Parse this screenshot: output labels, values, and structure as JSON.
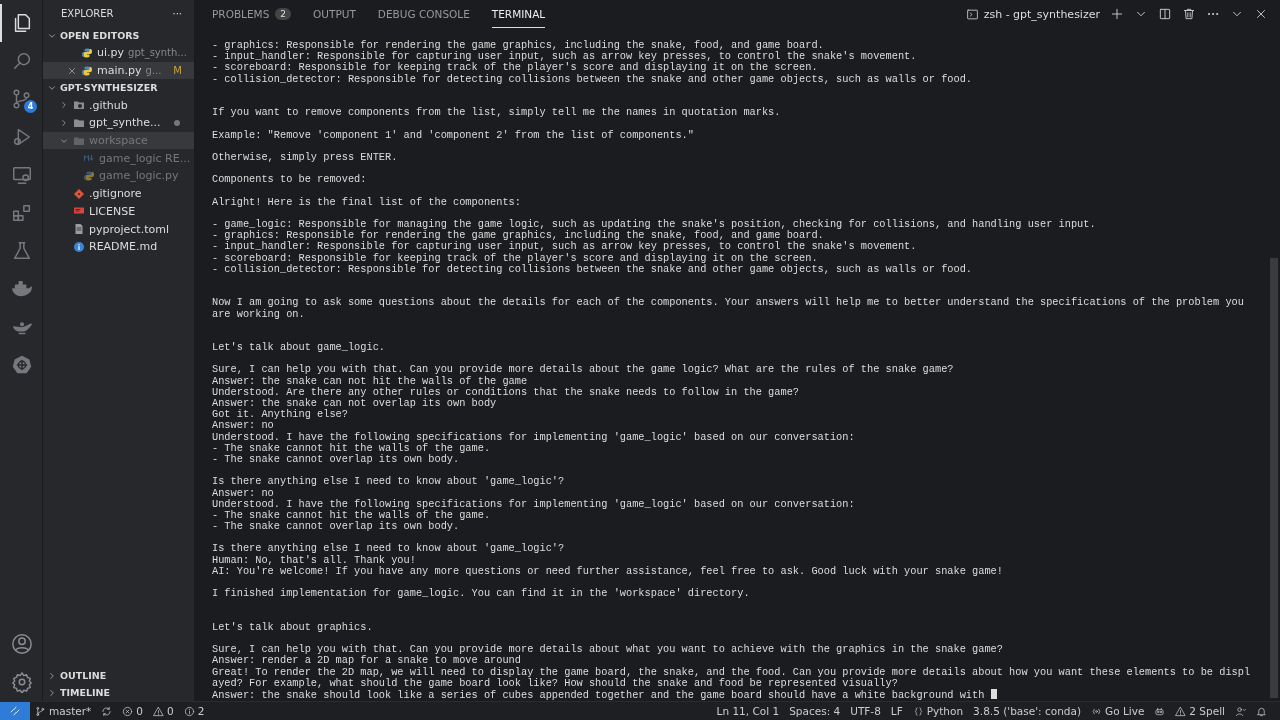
{
  "activity_bar": {
    "items": [
      {
        "kind": "files",
        "selected": true
      },
      {
        "kind": "search",
        "selected": false
      },
      {
        "kind": "source-control",
        "selected": false,
        "badge": "4"
      },
      {
        "kind": "debug",
        "selected": false
      },
      {
        "kind": "remote",
        "selected": false
      },
      {
        "kind": "extensions",
        "selected": false
      },
      {
        "kind": "testing",
        "selected": false
      },
      {
        "kind": "docker",
        "selected": false
      },
      {
        "kind": "lamp",
        "selected": false
      },
      {
        "kind": "helm",
        "selected": false
      }
    ],
    "bottom": [
      {
        "kind": "account"
      },
      {
        "kind": "settings"
      }
    ]
  },
  "sidebar": {
    "title": "EXPLORER",
    "more": "···",
    "sections": [
      {
        "title": "OPEN EDITORS",
        "expanded": true,
        "items": [
          {
            "name": "ui.py",
            "kind": "python",
            "description": "gpt_synth...",
            "selected": false,
            "close": false
          },
          {
            "name": "main.py",
            "kind": "python",
            "description": "g...",
            "selected": true,
            "close": true,
            "status": "M"
          }
        ]
      },
      {
        "title": "GPT-SYNTHESIZER",
        "expanded": true,
        "items": [
          {
            "name": ".github",
            "kind": "github-folder",
            "expanded": false,
            "ignored": false,
            "selected": false
          },
          {
            "name": "gpt_synthe...",
            "kind": "folder",
            "expanded": false,
            "ignored": false,
            "selected": false,
            "dot": true
          },
          {
            "name": "workspace",
            "kind": "folder",
            "expanded": true,
            "ignored": true,
            "selected": true,
            "children": [
              {
                "name": "game_logic RE...",
                "kind": "markdown",
                "ignored": true,
                "selected": false
              },
              {
                "name": "game_logic.py",
                "kind": "python",
                "ignored": true,
                "selected": false
              }
            ]
          },
          {
            "name": ".gitignore",
            "kind": "git",
            "ignored": false,
            "selected": false
          },
          {
            "name": "LICENSE",
            "kind": "license",
            "ignored": false,
            "selected": false
          },
          {
            "name": "pyproject.toml",
            "kind": "toml",
            "ignored": false,
            "selected": false
          },
          {
            "name": "README.md",
            "kind": "info",
            "ignored": false,
            "selected": false
          }
        ]
      }
    ],
    "bottom_sections": [
      {
        "title": "OUTLINE",
        "expanded": false
      },
      {
        "title": "TIMELINE",
        "expanded": false
      }
    ]
  },
  "panel": {
    "tabs": [
      {
        "label": "PROBLEMS",
        "selected": false,
        "badge": "2"
      },
      {
        "label": "OUTPUT",
        "selected": false
      },
      {
        "label": "DEBUG CONSOLE",
        "selected": false
      },
      {
        "label": "TERMINAL",
        "selected": true
      }
    ],
    "terminal_name": "zsh - gpt_synthesizer",
    "actions": [
      {
        "kind": "add"
      },
      {
        "kind": "chevron"
      },
      {
        "kind": "split"
      },
      {
        "kind": "trash"
      },
      {
        "kind": "more"
      },
      {
        "kind": "collapse"
      },
      {
        "kind": "close"
      }
    ],
    "terminal": [
      {
        "kind": "first",
        "lines": [
          "- graphics: Responsible for rendering the game graphics, including the snake, food, and game board.",
          "- input_handler: Responsible for capturing user input, such as arrow key presses, to control the snake's movement.",
          "- scoreboard: Responsible for keeping track of the player's score and displaying it on the screen.",
          "- collision_detector: Responsible for detecting collisions between the snake and other game objects, such as walls or food."
        ]
      },
      {
        "kind": "after_two_blanks",
        "lines": [
          "If you want to remove components from the list, simply tell me the names in quotation marks."
        ]
      },
      {
        "kind": "after_blank",
        "lines": [
          "Example: \"Remove 'component 1' and 'component 2' from the list of components.\""
        ]
      },
      {
        "kind": "after_blank",
        "lines": [
          "Otherwise, simply press ENTER."
        ]
      },
      {
        "kind": "after_blank",
        "lines": [
          "Components to be removed:"
        ]
      },
      {
        "kind": "after_blank",
        "lines": [
          "Alright! Here is the final list of the components:"
        ]
      },
      {
        "kind": "after_blank",
        "lines": [
          "- game_logic: Responsible for managing the game logic, such as updating the snake's position, checking for collisions, and handling user input.",
          "- graphics: Responsible for rendering the game graphics, including the snake, food, and game board.",
          "- input_handler: Responsible for capturing user input, such as arrow key presses, to control the snake's movement.",
          "- scoreboard: Responsible for keeping track of the player's score and displaying it on the screen.",
          "- collision_detector: Responsible for detecting collisions between the snake and other game objects, such as walls or food."
        ]
      },
      {
        "kind": "after_two_blanks",
        "lines": [
          "Now I am going to ask some questions about the details for each of the components. Your answers will help me to better understand the specifications of the problem you",
          "are working on."
        ]
      },
      {
        "kind": "after_two_blanks",
        "lines": [
          "Let's talk about game_logic."
        ]
      },
      {
        "kind": "after_blank",
        "lines": [
          "Sure, I can help you with that. Can you provide more details about the game logic? What are the rules of the snake game?",
          "Answer: the snake can not hit the walls of the game",
          "Understood. Are there any other rules or conditions that the snake needs to follow in the game?",
          "Answer: the snake can not overlap its own body",
          "Got it. Anything else?",
          "Answer: no",
          "Understood. I have the following specifications for implementing 'game_logic' based on our conversation:",
          "- The snake cannot hit the walls of the game.",
          "- The snake cannot overlap its own body."
        ]
      },
      {
        "kind": "after_blank",
        "lines": [
          "Is there anything else I need to know about 'game_logic'?",
          "Answer: no",
          "Understood. I have the following specifications for implementing 'game_logic' based on our conversation:",
          "- The snake cannot hit the walls of the game.",
          "- The snake cannot overlap its own body."
        ]
      },
      {
        "kind": "after_blank",
        "lines": [
          "Is there anything else I need to know about 'game_logic'?",
          "Human: No, that's all. Thank you!",
          "AI: You're welcome! If you have any more questions or need further assistance, feel free to ask. Good luck with your snake game!"
        ]
      },
      {
        "kind": "after_blank",
        "lines": [
          "I finished implementation for game_logic. You can find it in the 'workspace' directory."
        ]
      },
      {
        "kind": "after_two_blanks",
        "lines": [
          "Let's talk about graphics."
        ]
      },
      {
        "kind": "after_blank",
        "lines": [
          "Sure, I can help you with that. Can you provide more details about what you want to achieve with the graphics in the snake game?",
          "Answer: render a 2D map for a snake to move around",
          "Great! To render the 2D map, we will need to display the game board, the snake, and the food. Can you provide more details about how you want these elements to be displ",
          "ayed? For example, what should the game board look like? How should the snake and food be represented visually?",
          "Answer: the snake should look like a series of cubes appended together and the game board should have a white background with "
        ]
      }
    ],
    "cursor": true
  },
  "status_bar": {
    "left": [
      {
        "kind": "branch",
        "text": "master*"
      },
      {
        "kind": "sync"
      },
      {
        "kind": "error",
        "text": "0"
      },
      {
        "kind": "warning",
        "text": "0"
      },
      {
        "kind": "info",
        "text": "2"
      }
    ],
    "right": [
      {
        "kind": "text",
        "text": "Ln 11, Col 1"
      },
      {
        "kind": "text",
        "text": "Spaces: 4"
      },
      {
        "kind": "text",
        "text": "UTF-8"
      },
      {
        "kind": "text",
        "text": "LF"
      },
      {
        "kind": "braces",
        "text": "Python"
      },
      {
        "kind": "text",
        "text": "3.8.5 ('base': conda)"
      },
      {
        "kind": "broadcast",
        "text": "Go Live"
      },
      {
        "kind": "copilot"
      },
      {
        "kind": "warning",
        "text": "2 Spell"
      },
      {
        "kind": "person"
      },
      {
        "kind": "bell"
      }
    ]
  }
}
